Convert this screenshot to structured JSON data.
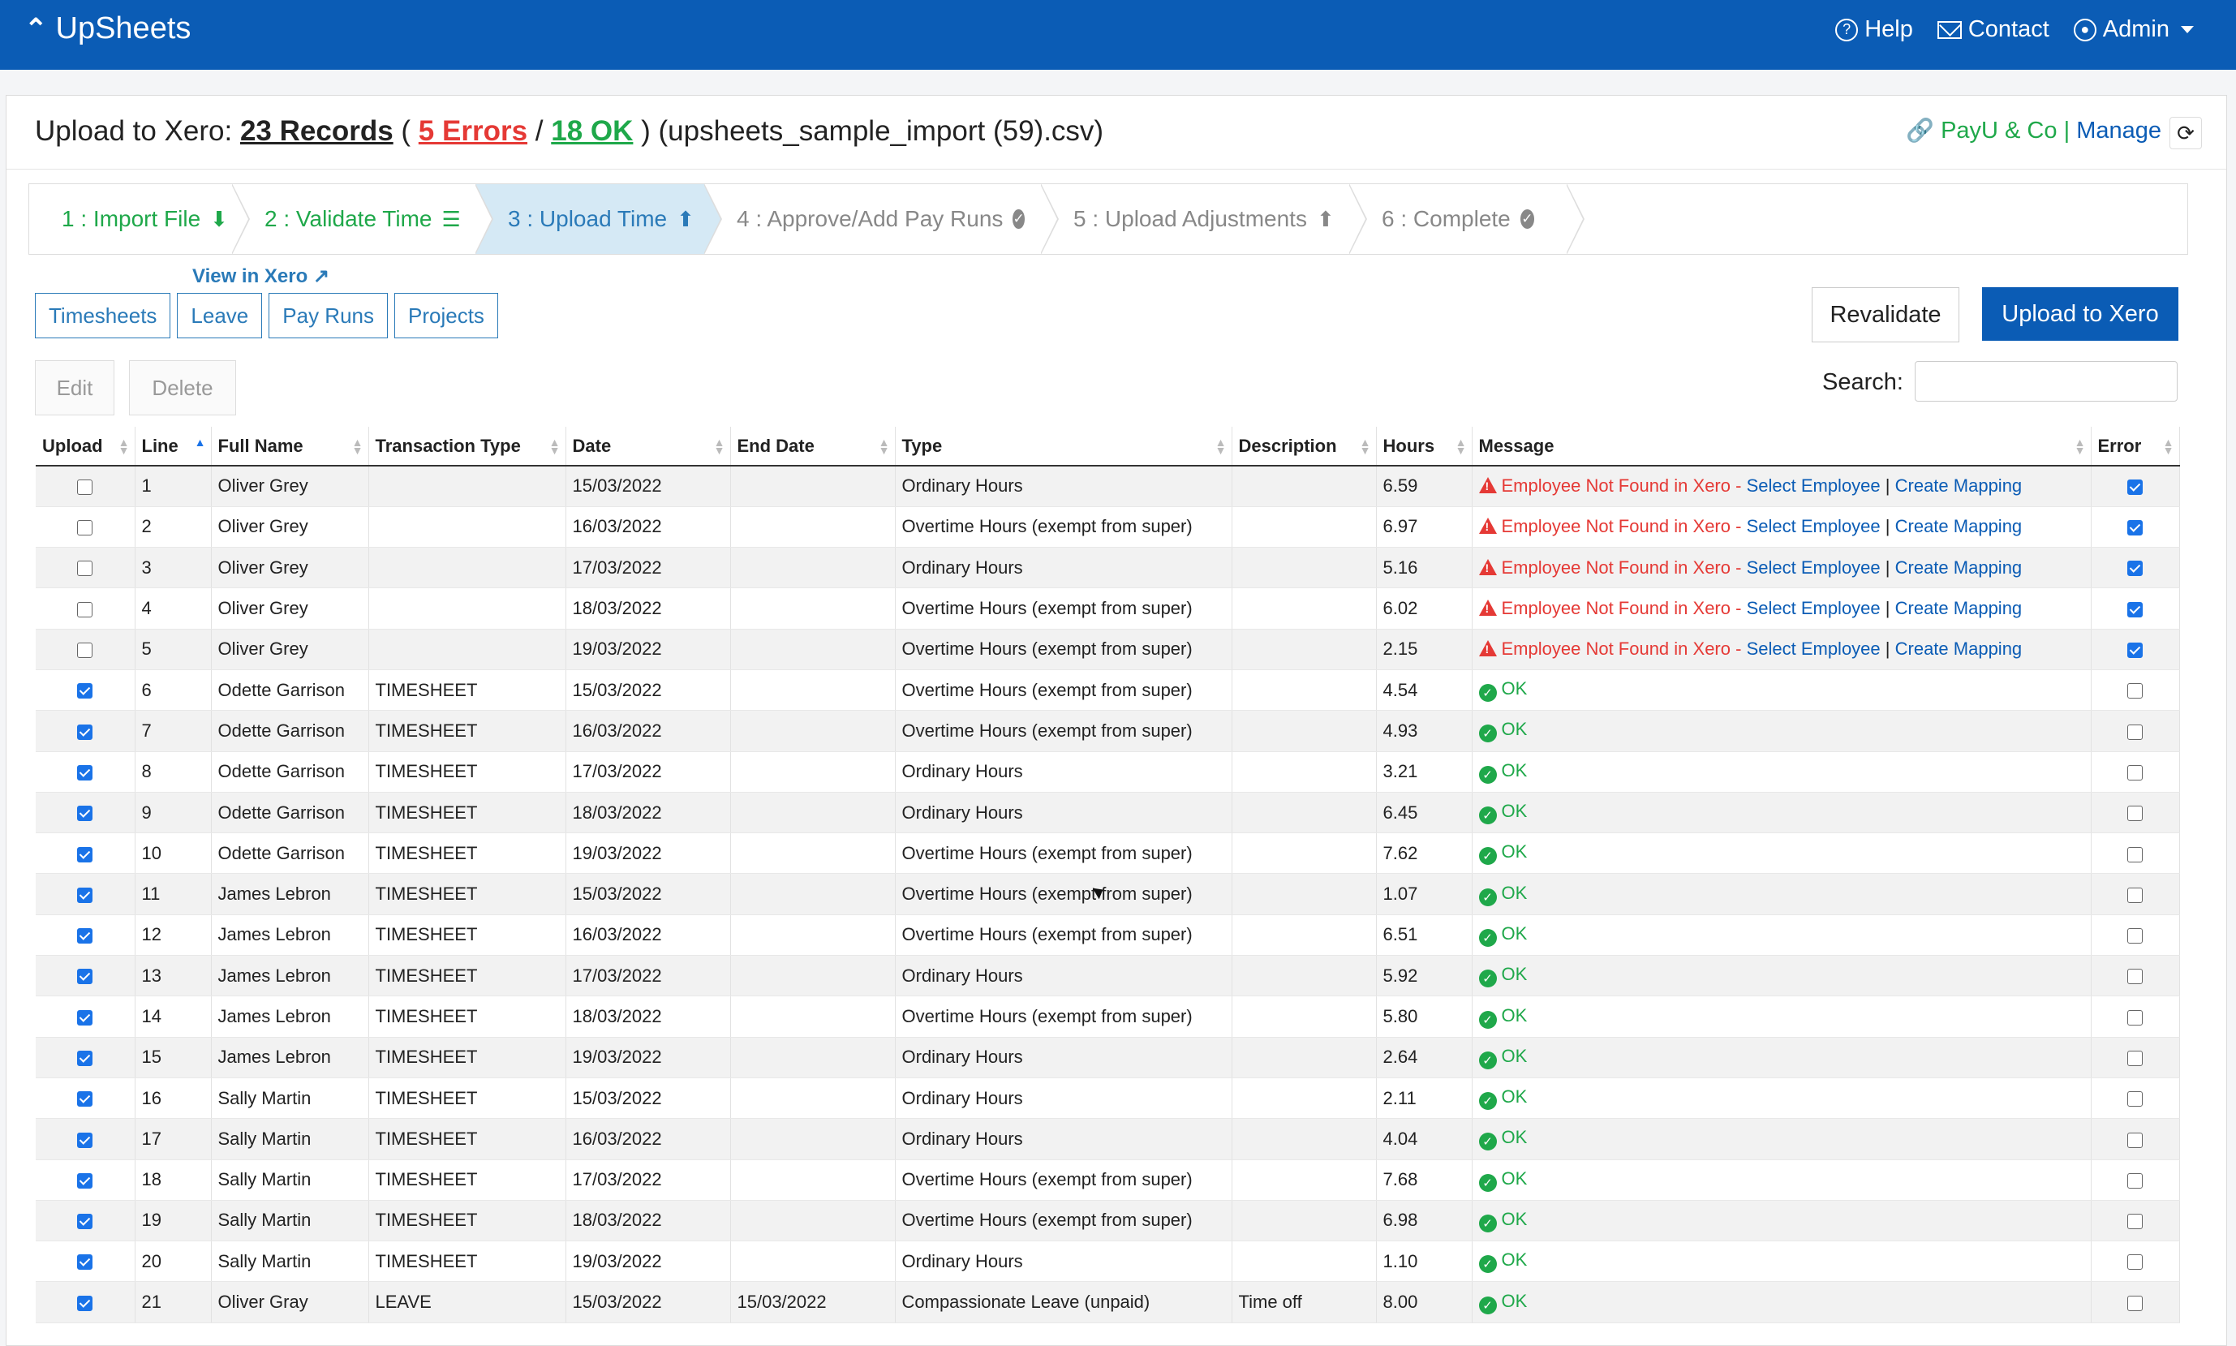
{
  "navbar": {
    "brand": "UpSheets",
    "help": "Help",
    "contact": "Contact",
    "admin": "Admin"
  },
  "header": {
    "title_prefix": "Upload to Xero:",
    "records": "23 Records",
    "paren_open": "(",
    "errors": "5 Errors",
    "slash": "/",
    "ok": "18 OK",
    "paren_close": ")",
    "filename": "(upsheets_sample_import (59).csv)",
    "org_name": "PayU & Co",
    "org_sep": "|",
    "manage": "Manage"
  },
  "wizard": {
    "steps": [
      {
        "label": "1 : Import File"
      },
      {
        "label": "2 : Validate Time"
      },
      {
        "label": "3 : Upload Time"
      },
      {
        "label": "4 : Approve/Add Pay Runs"
      },
      {
        "label": "5 : Upload Adjustments"
      },
      {
        "label": "6 : Complete"
      }
    ]
  },
  "view_in_xero": "View in Xero",
  "tabs": [
    "Timesheets",
    "Leave",
    "Pay Runs",
    "Projects"
  ],
  "actions": {
    "revalidate": "Revalidate",
    "upload": "Upload to Xero",
    "edit": "Edit",
    "delete": "Delete",
    "search_label": "Search:",
    "search_value": ""
  },
  "table": {
    "columns": [
      "Upload",
      "Line",
      "Full Name",
      "Transaction Type",
      "Date",
      "End Date",
      "Type",
      "Description",
      "Hours",
      "Message",
      "Error"
    ],
    "error_message": {
      "text": "Employee Not Found in Xero -",
      "select": "Select Employee",
      "sep": "|",
      "mapping": "Create Mapping"
    },
    "ok_text": "OK",
    "rows": [
      {
        "upload": false,
        "line": "1",
        "name": "Oliver Grey",
        "ttype": "",
        "date": "15/03/2022",
        "end": "",
        "type": "Ordinary Hours",
        "desc": "",
        "hours": "6.59",
        "status": "error",
        "error": true
      },
      {
        "upload": false,
        "line": "2",
        "name": "Oliver Grey",
        "ttype": "",
        "date": "16/03/2022",
        "end": "",
        "type": "Overtime Hours (exempt from super)",
        "desc": "",
        "hours": "6.97",
        "status": "error",
        "error": true
      },
      {
        "upload": false,
        "line": "3",
        "name": "Oliver Grey",
        "ttype": "",
        "date": "17/03/2022",
        "end": "",
        "type": "Ordinary Hours",
        "desc": "",
        "hours": "5.16",
        "status": "error",
        "error": true
      },
      {
        "upload": false,
        "line": "4",
        "name": "Oliver Grey",
        "ttype": "",
        "date": "18/03/2022",
        "end": "",
        "type": "Overtime Hours (exempt from super)",
        "desc": "",
        "hours": "6.02",
        "status": "error",
        "error": true
      },
      {
        "upload": false,
        "line": "5",
        "name": "Oliver Grey",
        "ttype": "",
        "date": "19/03/2022",
        "end": "",
        "type": "Overtime Hours (exempt from super)",
        "desc": "",
        "hours": "2.15",
        "status": "error",
        "error": true
      },
      {
        "upload": true,
        "line": "6",
        "name": "Odette Garrison",
        "ttype": "TIMESHEET",
        "date": "15/03/2022",
        "end": "",
        "type": "Overtime Hours (exempt from super)",
        "desc": "",
        "hours": "4.54",
        "status": "ok",
        "error": false
      },
      {
        "upload": true,
        "line": "7",
        "name": "Odette Garrison",
        "ttype": "TIMESHEET",
        "date": "16/03/2022",
        "end": "",
        "type": "Overtime Hours (exempt from super)",
        "desc": "",
        "hours": "4.93",
        "status": "ok",
        "error": false
      },
      {
        "upload": true,
        "line": "8",
        "name": "Odette Garrison",
        "ttype": "TIMESHEET",
        "date": "17/03/2022",
        "end": "",
        "type": "Ordinary Hours",
        "desc": "",
        "hours": "3.21",
        "status": "ok",
        "error": false
      },
      {
        "upload": true,
        "line": "9",
        "name": "Odette Garrison",
        "ttype": "TIMESHEET",
        "date": "18/03/2022",
        "end": "",
        "type": "Ordinary Hours",
        "desc": "",
        "hours": "6.45",
        "status": "ok",
        "error": false
      },
      {
        "upload": true,
        "line": "10",
        "name": "Odette Garrison",
        "ttype": "TIMESHEET",
        "date": "19/03/2022",
        "end": "",
        "type": "Overtime Hours (exempt from super)",
        "desc": "",
        "hours": "7.62",
        "status": "ok",
        "error": false
      },
      {
        "upload": true,
        "line": "11",
        "name": "James Lebron",
        "ttype": "TIMESHEET",
        "date": "15/03/2022",
        "end": "",
        "type": "Overtime Hours (exempt from super)",
        "desc": "",
        "hours": "1.07",
        "status": "ok",
        "error": false
      },
      {
        "upload": true,
        "line": "12",
        "name": "James Lebron",
        "ttype": "TIMESHEET",
        "date": "16/03/2022",
        "end": "",
        "type": "Overtime Hours (exempt from super)",
        "desc": "",
        "hours": "6.51",
        "status": "ok",
        "error": false
      },
      {
        "upload": true,
        "line": "13",
        "name": "James Lebron",
        "ttype": "TIMESHEET",
        "date": "17/03/2022",
        "end": "",
        "type": "Ordinary Hours",
        "desc": "",
        "hours": "5.92",
        "status": "ok",
        "error": false
      },
      {
        "upload": true,
        "line": "14",
        "name": "James Lebron",
        "ttype": "TIMESHEET",
        "date": "18/03/2022",
        "end": "",
        "type": "Overtime Hours (exempt from super)",
        "desc": "",
        "hours": "5.80",
        "status": "ok",
        "error": false
      },
      {
        "upload": true,
        "line": "15",
        "name": "James Lebron",
        "ttype": "TIMESHEET",
        "date": "19/03/2022",
        "end": "",
        "type": "Ordinary Hours",
        "desc": "",
        "hours": "2.64",
        "status": "ok",
        "error": false
      },
      {
        "upload": true,
        "line": "16",
        "name": "Sally Martin",
        "ttype": "TIMESHEET",
        "date": "15/03/2022",
        "end": "",
        "type": "Ordinary Hours",
        "desc": "",
        "hours": "2.11",
        "status": "ok",
        "error": false
      },
      {
        "upload": true,
        "line": "17",
        "name": "Sally Martin",
        "ttype": "TIMESHEET",
        "date": "16/03/2022",
        "end": "",
        "type": "Ordinary Hours",
        "desc": "",
        "hours": "4.04",
        "status": "ok",
        "error": false
      },
      {
        "upload": true,
        "line": "18",
        "name": "Sally Martin",
        "ttype": "TIMESHEET",
        "date": "17/03/2022",
        "end": "",
        "type": "Overtime Hours (exempt from super)",
        "desc": "",
        "hours": "7.68",
        "status": "ok",
        "error": false
      },
      {
        "upload": true,
        "line": "19",
        "name": "Sally Martin",
        "ttype": "TIMESHEET",
        "date": "18/03/2022",
        "end": "",
        "type": "Overtime Hours (exempt from super)",
        "desc": "",
        "hours": "6.98",
        "status": "ok",
        "error": false
      },
      {
        "upload": true,
        "line": "20",
        "name": "Sally Martin",
        "ttype": "TIMESHEET",
        "date": "19/03/2022",
        "end": "",
        "type": "Ordinary Hours",
        "desc": "",
        "hours": "1.10",
        "status": "ok",
        "error": false
      },
      {
        "upload": true,
        "line": "21",
        "name": "Oliver Gray",
        "ttype": "LEAVE",
        "date": "15/03/2022",
        "end": "15/03/2022",
        "type": "Compassionate Leave (unpaid)",
        "desc": "Time off",
        "hours": "8.00",
        "status": "ok",
        "error": false
      }
    ]
  },
  "colors": {
    "navbar": "#0b5cb5",
    "error": "#e53935",
    "ok": "#1fa84a",
    "link": "#2a7ab8"
  }
}
